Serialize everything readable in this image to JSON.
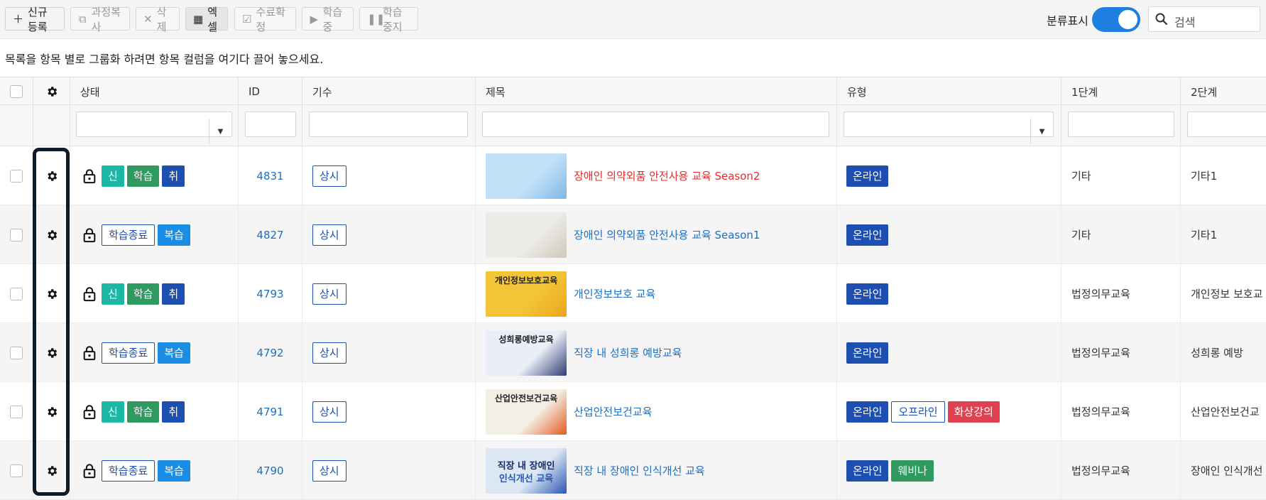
{
  "toolbar": {
    "new": "신규등록",
    "copy": "과정복사",
    "delete": "삭제",
    "excel": "엑셀",
    "complete": "수료확정",
    "learning": "학습중",
    "stop": "학습중지",
    "toggle_label": "분류표시",
    "toggle_on": true,
    "search_placeholder": "검색"
  },
  "group_hint": "목록을 항목 별로 그룹화 하려면 항목 컬럼을 여기다 끌어 놓으세요.",
  "columns": {
    "status": "상태",
    "id": "ID",
    "term": "기수",
    "title": "제목",
    "type": "유형",
    "level1": "1단계",
    "level2": "2단계"
  },
  "rows": [
    {
      "status": [
        "신",
        "학습",
        "취"
      ],
      "id": "4831",
      "term": "상시",
      "title": "장애인 의약외품 안전사용 교육 Season2",
      "title_color": "red",
      "types": [
        "온라인"
      ],
      "level1": "기타",
      "level2": "기타1"
    },
    {
      "status": [
        "학습종료",
        "복습"
      ],
      "id": "4827",
      "term": "상시",
      "title": "장애인 의약외품 안전사용 교육 Season1",
      "title_color": "blue",
      "types": [
        "온라인"
      ],
      "level1": "기타",
      "level2": "기타1"
    },
    {
      "status": [
        "신",
        "학습",
        "취"
      ],
      "id": "4793",
      "term": "상시",
      "title": "개인정보보호 교육",
      "title_color": "blue",
      "types": [
        "온라인"
      ],
      "level1": "법정의무교육",
      "level2": "개인정보 보호교"
    },
    {
      "status": [
        "학습종료",
        "복습"
      ],
      "id": "4792",
      "term": "상시",
      "title": "직장 내 성희롱 예방교육",
      "title_color": "blue",
      "types": [
        "온라인"
      ],
      "level1": "법정의무교육",
      "level2": "성희롱 예방"
    },
    {
      "status": [
        "신",
        "학습",
        "취"
      ],
      "id": "4791",
      "term": "상시",
      "title": "산업안전보건교육",
      "title_color": "blue",
      "types": [
        "온라인",
        "오프라인",
        "화상강의"
      ],
      "level1": "법정의무교육",
      "level2": "산업안전보건교"
    },
    {
      "status": [
        "학습종료",
        "복습"
      ],
      "id": "4790",
      "term": "상시",
      "title": "직장 내 장애인 인식개선 교육",
      "title_color": "blue",
      "types": [
        "온라인",
        "웨비나"
      ],
      "level1": "법정의무교육",
      "level2": "장애인 인식개선"
    }
  ],
  "thumbnails": [
    {
      "text": ""
    },
    {
      "text": ""
    },
    {
      "text": "개인정보보호교육"
    },
    {
      "text": "성희롱예방교육"
    },
    {
      "text": "산업안전보건교육"
    },
    {
      "line1": "직장 내 장애인",
      "line2": "인식개선 교육"
    }
  ]
}
